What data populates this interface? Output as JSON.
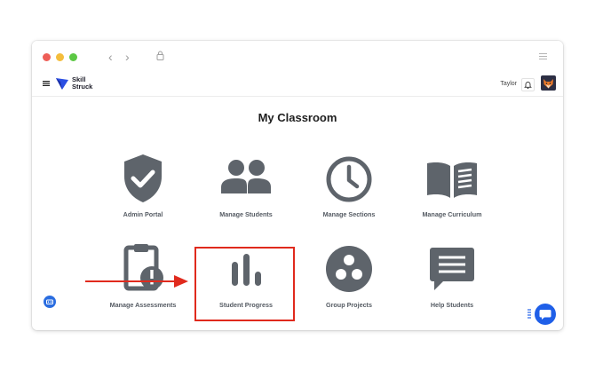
{
  "app": {
    "logo_line1": "Skill",
    "logo_line2": "Struck",
    "user_name": "Taylor"
  },
  "page": {
    "title": "My Classroom"
  },
  "tiles": [
    {
      "label": "Admin Portal",
      "icon": "shield-check-icon"
    },
    {
      "label": "Manage Students",
      "icon": "users-icon"
    },
    {
      "label": "Manage Sections",
      "icon": "clock-icon"
    },
    {
      "label": "Manage Curriculum",
      "icon": "open-book-icon"
    },
    {
      "label": "Manage Assessments",
      "icon": "clipboard-alert-icon"
    },
    {
      "label": "Student Progress",
      "icon": "bar-chart-icon"
    },
    {
      "label": "Group Projects",
      "icon": "group-circle-icon"
    },
    {
      "label": "Help Students",
      "icon": "message-icon"
    }
  ],
  "colors": {
    "icon": "#5e646b",
    "highlight": "#e02a1d",
    "accent": "#1f5fe8"
  }
}
